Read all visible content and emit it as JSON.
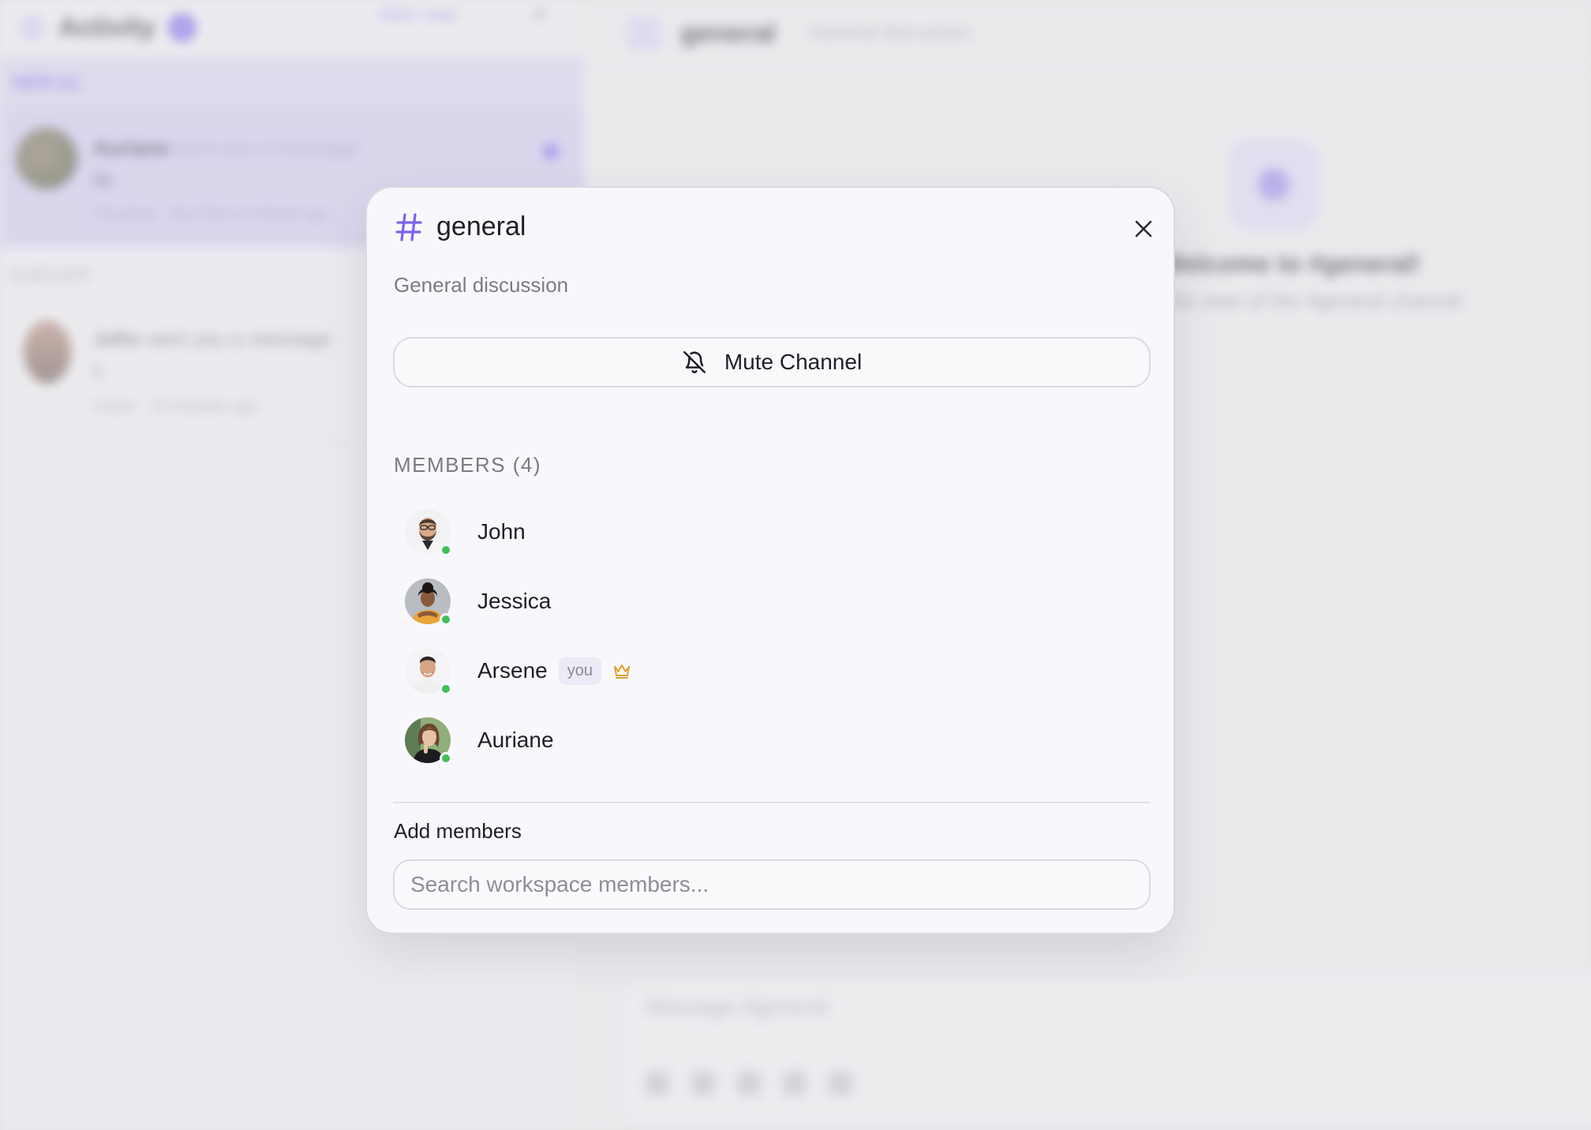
{
  "background": {
    "sidebar": {
      "title": "Activity",
      "badge_count": "1",
      "mark_read_label": "Mark read",
      "new_section_label": "NEW (1)",
      "notifications": [
        {
          "actor": "Auriane",
          "action": "sent you a message",
          "message": "Hi",
          "channel": "#Auriane",
          "time": "less than a minute ago"
        },
        {
          "actor": "John",
          "action": "sent you a message",
          "message": "h",
          "channel": "#John",
          "time": "15 minutes ago"
        }
      ],
      "earlier_label": "EARLIER"
    },
    "channel_header": {
      "name": "general",
      "description": "General discussion"
    },
    "welcome": {
      "title": "Welcome to #general!",
      "subtitle": "the start of the #general channel"
    },
    "composer": {
      "placeholder": "Message #general"
    }
  },
  "modal": {
    "channel_name": "general",
    "description": "General discussion",
    "mute_label": "Mute Channel",
    "members_label": "MEMBERS",
    "members_count": "(4)",
    "members": [
      {
        "name": "John",
        "online": true
      },
      {
        "name": "Jessica",
        "online": true
      },
      {
        "name": "Arsene",
        "online": true,
        "you_label": "you",
        "owner": true
      },
      {
        "name": "Auriane",
        "online": true
      }
    ],
    "add_members_label": "Add members",
    "search_placeholder": "Search workspace members..."
  },
  "colors": {
    "accent": "#7a63f0",
    "online": "#3fbf5a",
    "owner_crown": "#e0a030"
  },
  "icons": {
    "channel": "hash-icon",
    "close": "close-icon",
    "mute": "bell-off-icon",
    "owner": "crown-icon"
  }
}
